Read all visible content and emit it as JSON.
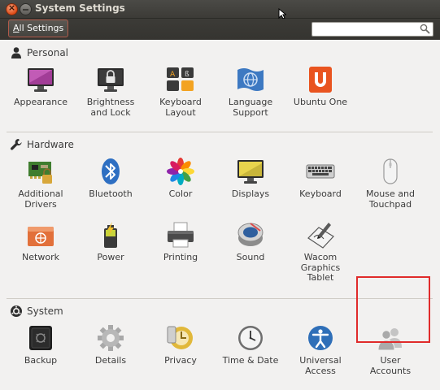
{
  "window": {
    "title": "System Settings"
  },
  "toolbar": {
    "all_settings_label": "All Settings",
    "search": {
      "value": "",
      "placeholder": ""
    }
  },
  "sections": {
    "personal": {
      "title": "Personal",
      "items": [
        {
          "label": "Appearance",
          "icon": "appearance-icon"
        },
        {
          "label": "Brightness\nand Lock",
          "icon": "brightness-lock-icon"
        },
        {
          "label": "Keyboard\nLayout",
          "icon": "keyboard-layout-icon"
        },
        {
          "label": "Language\nSupport",
          "icon": "language-support-icon"
        },
        {
          "label": "Ubuntu One",
          "icon": "ubuntu-one-icon"
        }
      ]
    },
    "hardware": {
      "title": "Hardware",
      "items": [
        {
          "label": "Additional\nDrivers",
          "icon": "additional-drivers-icon"
        },
        {
          "label": "Bluetooth",
          "icon": "bluetooth-icon"
        },
        {
          "label": "Color",
          "icon": "color-icon"
        },
        {
          "label": "Displays",
          "icon": "displays-icon"
        },
        {
          "label": "Keyboard",
          "icon": "keyboard-icon"
        },
        {
          "label": "Mouse and\nTouchpad",
          "icon": "mouse-icon"
        },
        {
          "label": "Network",
          "icon": "network-icon"
        },
        {
          "label": "Power",
          "icon": "power-icon"
        },
        {
          "label": "Printing",
          "icon": "printer-icon"
        },
        {
          "label": "Sound",
          "icon": "sound-icon"
        },
        {
          "label": "Wacom\nGraphics\nTablet",
          "icon": "wacom-tablet-icon"
        }
      ]
    },
    "system": {
      "title": "System",
      "items": [
        {
          "label": "Backup",
          "icon": "backup-icon"
        },
        {
          "label": "Details",
          "icon": "details-icon"
        },
        {
          "label": "Privacy",
          "icon": "privacy-icon"
        },
        {
          "label": "Time & Date",
          "icon": "clock-icon"
        },
        {
          "label": "Universal\nAccess",
          "icon": "universal-access-icon"
        },
        {
          "label": "User\nAccounts",
          "icon": "user-accounts-icon",
          "highlighted": true
        }
      ]
    }
  },
  "colors": {
    "highlight_border": "#e02b2b",
    "titlebar": "#3c3b37",
    "background": "#f2f1f0"
  }
}
